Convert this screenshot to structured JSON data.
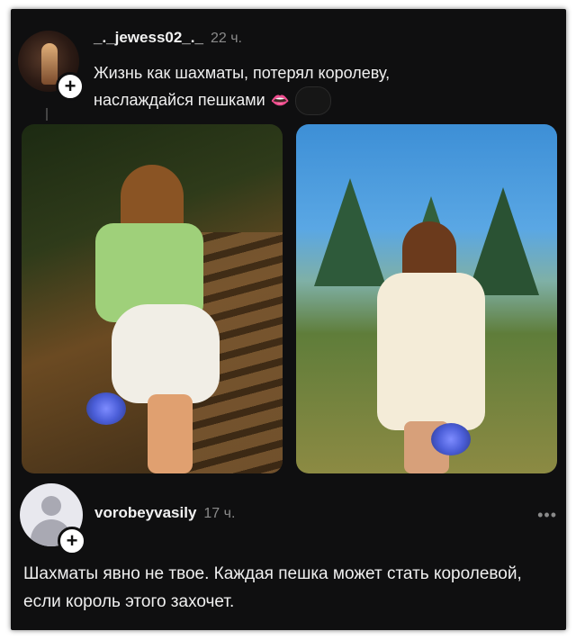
{
  "comment1": {
    "username": "_._jewess02_._",
    "time": "22 ч.",
    "text": "Жизнь как шахматы, потерял королеву, наслаждайся пешками",
    "emoji": "👄",
    "plus_symbol": "+"
  },
  "comment2": {
    "username": "vorobeyvasily",
    "time": "17 ч.",
    "more_label": "•••",
    "text": "Шахматы явно не твое. Каждая пешка может стать королевой, если король этого захочет.",
    "plus_symbol": "+"
  },
  "colors": {
    "background": "#0f0f10",
    "text": "#f0f0f0",
    "muted": "#8a8a8a"
  }
}
